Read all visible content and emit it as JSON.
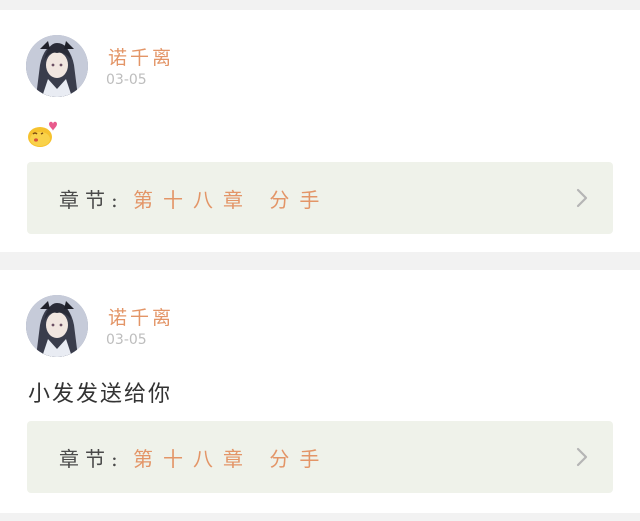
{
  "comments": [
    {
      "username": "诺千离",
      "date": "03-05",
      "text": "",
      "emoji": "kiss-heart-emoji",
      "chapter_label": "章节:",
      "chapter_title": "第十八章 分手"
    },
    {
      "username": "诺千离",
      "date": "03-05",
      "text": "小发发送给你",
      "chapter_label": "章节:",
      "chapter_title": "第十八章 分手"
    }
  ],
  "colors": {
    "accent": "#e39567",
    "chapter_bg": "#eff2ea",
    "muted": "#bdbdbd"
  }
}
